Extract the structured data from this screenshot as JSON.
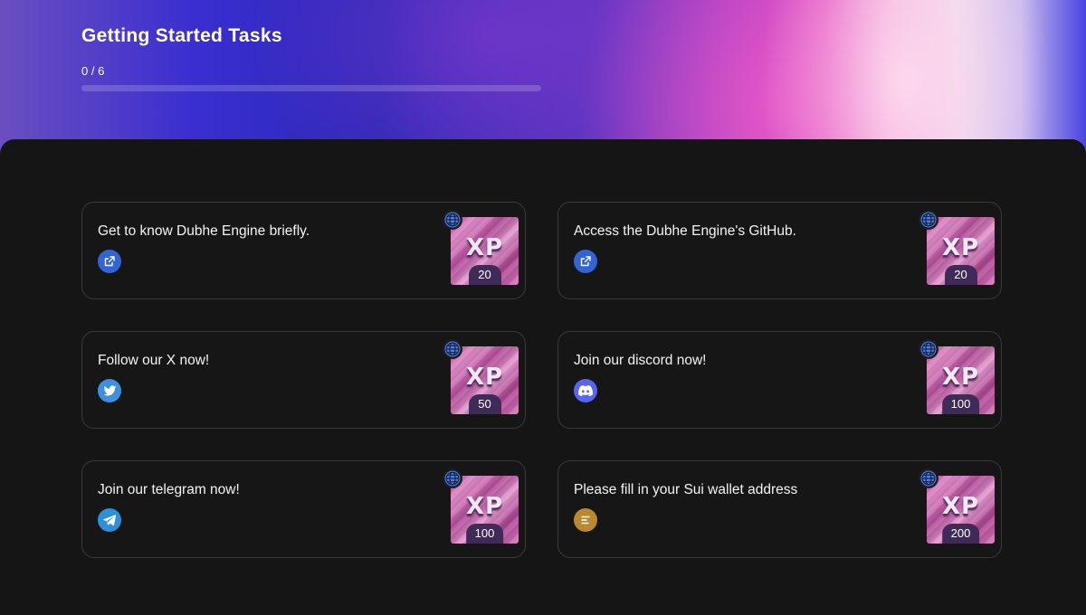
{
  "header": {
    "title": "Getting Started Tasks",
    "progress_text": "0 / 6",
    "progress_completed": 0,
    "progress_total": 6
  },
  "colors": {
    "link_icon_bg": "#3264d6",
    "twitter_icon_bg": "#3d8fe0",
    "discord_icon_bg": "#5865f2",
    "telegram_icon_bg": "#2f8fd8",
    "wallet_icon_bg": "#b8892e",
    "xp_badge_bg": "#3f2b57",
    "globe_icon": "#4f7de8"
  },
  "tasks": [
    {
      "title": "Get to know Dubhe Engine briefly.",
      "icon": "external-link-icon",
      "xp_label": "XP",
      "xp": "20"
    },
    {
      "title": "Access the Dubhe Engine's GitHub.",
      "icon": "external-link-icon",
      "xp_label": "XP",
      "xp": "20"
    },
    {
      "title": "Follow our X now!",
      "icon": "twitter-icon",
      "xp_label": "XP",
      "xp": "50"
    },
    {
      "title": "Join our discord now!",
      "icon": "discord-icon",
      "xp_label": "XP",
      "xp": "100"
    },
    {
      "title": "Join our telegram now!",
      "icon": "telegram-icon",
      "xp_label": "XP",
      "xp": "100"
    },
    {
      "title": "Please fill in your Sui wallet address",
      "icon": "wallet-form-icon",
      "xp_label": "XP",
      "xp": "200"
    }
  ]
}
